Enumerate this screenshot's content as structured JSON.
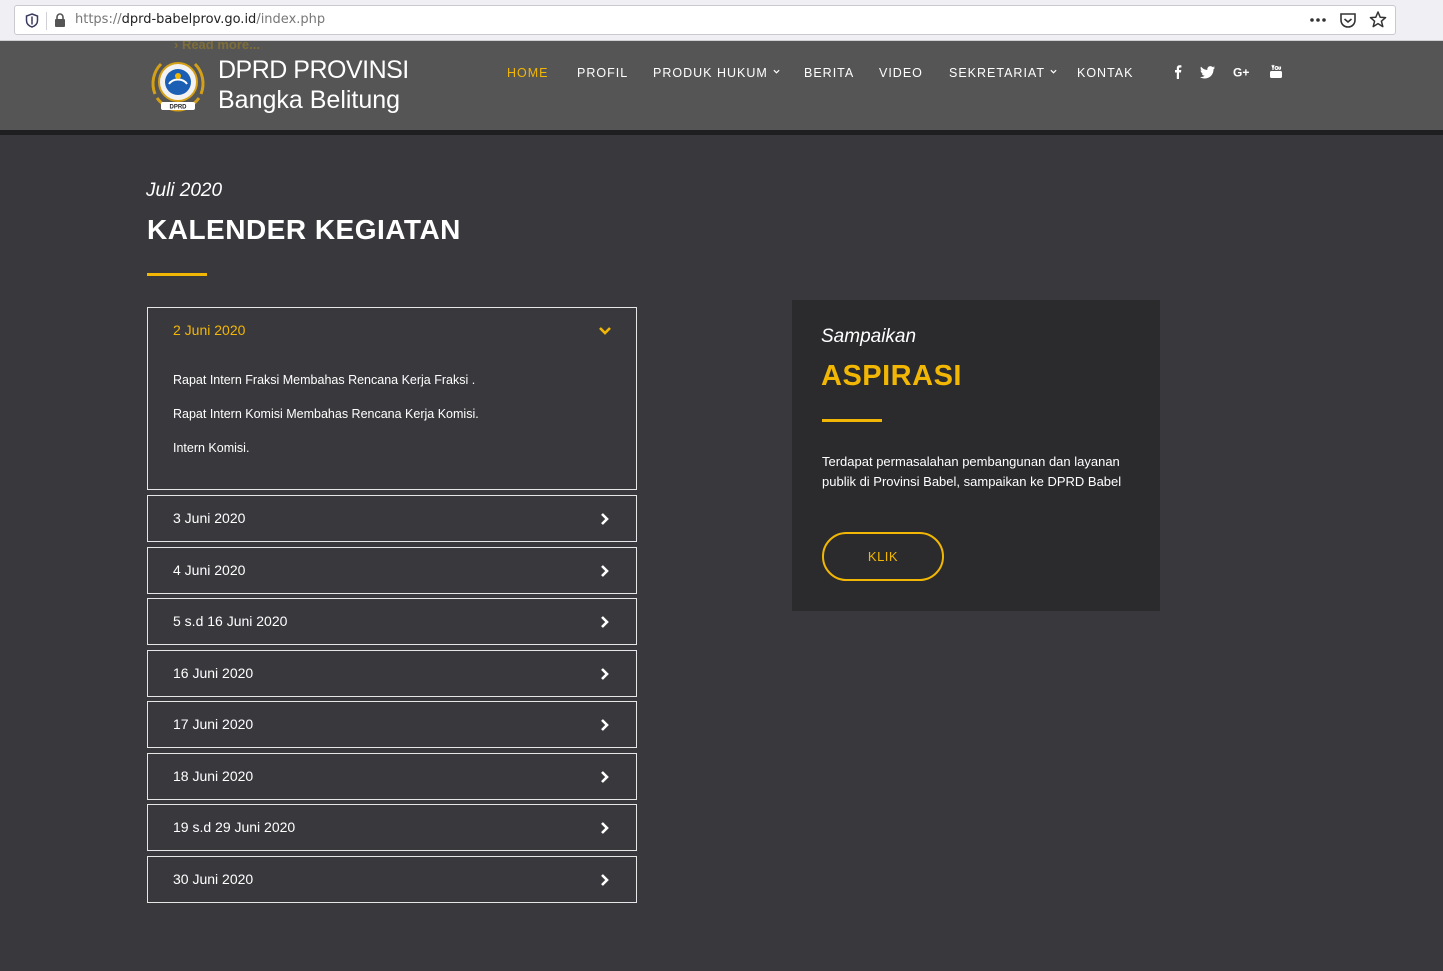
{
  "browser": {
    "url_prefix": "https://",
    "url_host": "dprd-babelprov.go.id",
    "url_path": "/index.php",
    "icons": [
      "tracking-shield-icon",
      "lock-icon",
      "more-actions-icon",
      "pocket-icon",
      "bookmark-star-icon"
    ]
  },
  "header": {
    "readmore_ghost": "› Read more...",
    "brand_line1": "DPRD PROVINSI",
    "brand_line2": "Bangka Belitung",
    "nav": [
      {
        "label": "HOME",
        "active": true
      },
      {
        "label": "PROFIL"
      },
      {
        "label": "PRODUK HUKUM",
        "dropdown": true
      },
      {
        "label": "BERITA"
      },
      {
        "label": "VIDEO"
      },
      {
        "label": "SEKRETARIAT",
        "dropdown": true
      },
      {
        "label": "KONTAK"
      }
    ],
    "social": [
      "facebook-icon",
      "twitter-icon",
      "google-plus-icon",
      "youtube-icon"
    ]
  },
  "calendar": {
    "month": "Juli 2020",
    "title": "KALENDER KEGIATAN",
    "open_item": {
      "date": "2 Juni 2020",
      "lines": [
        "Rapat Intern Fraksi Membahas Rencana Kerja Fraksi .",
        "Rapat Intern Komisi Membahas Rencana Kerja Komisi.",
        "Intern Komisi."
      ]
    },
    "items": [
      "3 Juni 2020",
      "4 Juni 2020",
      "5 s.d 16 Juni 2020",
      "16 Juni 2020",
      "17 Juni 2020",
      "18 Juni 2020",
      "19 s.d 29 Juni 2020",
      "30 Juni 2020"
    ]
  },
  "aspirasi": {
    "kicker": "Sampaikan",
    "title": "ASPIRASI",
    "text": "Terdapat permasalahan pembangunan dan layanan publik di Provinsi Babel, sampaikan ke DPRD Babel",
    "button": "KLIK"
  },
  "colors": {
    "accent": "#f2b705",
    "page_bg": "#39383d",
    "header_bg": "#555555",
    "box_bg": "#2b2b2e"
  }
}
